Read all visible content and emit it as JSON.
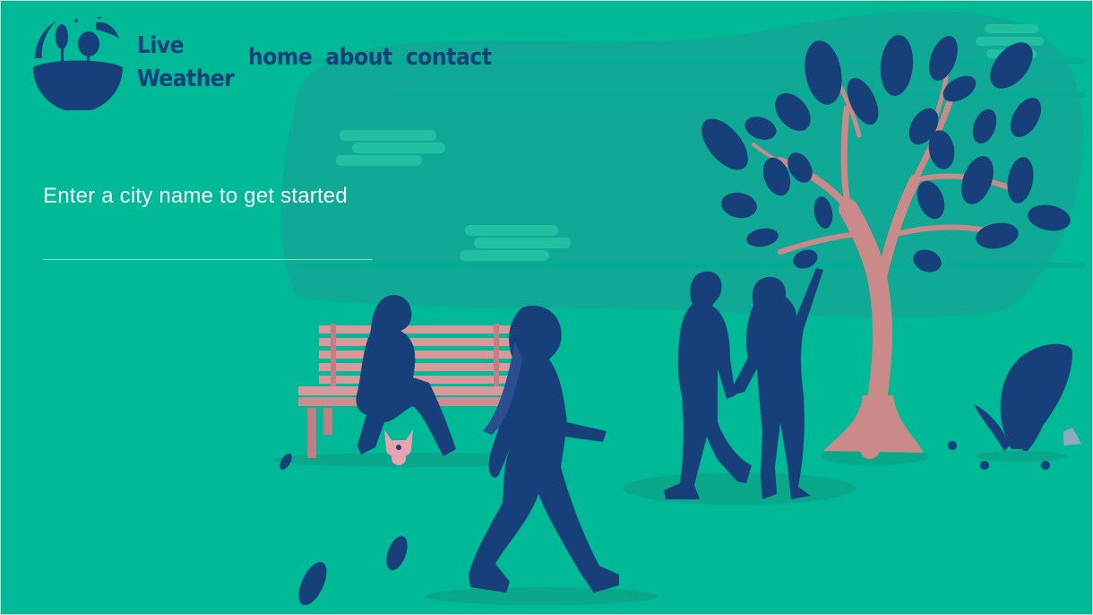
{
  "brand": {
    "line1": "Live",
    "line2": "Weather"
  },
  "nav": {
    "home": "home",
    "about": "about",
    "contact": "contact"
  },
  "search": {
    "prompt": "Enter a city name to get started",
    "value": "",
    "placeholder": ""
  },
  "colors": {
    "background": "#00b996",
    "accent": "#173f7a",
    "tree_trunk": "#c98a89",
    "bench": "#d9989a",
    "input_underline": "#8fdcc9"
  }
}
